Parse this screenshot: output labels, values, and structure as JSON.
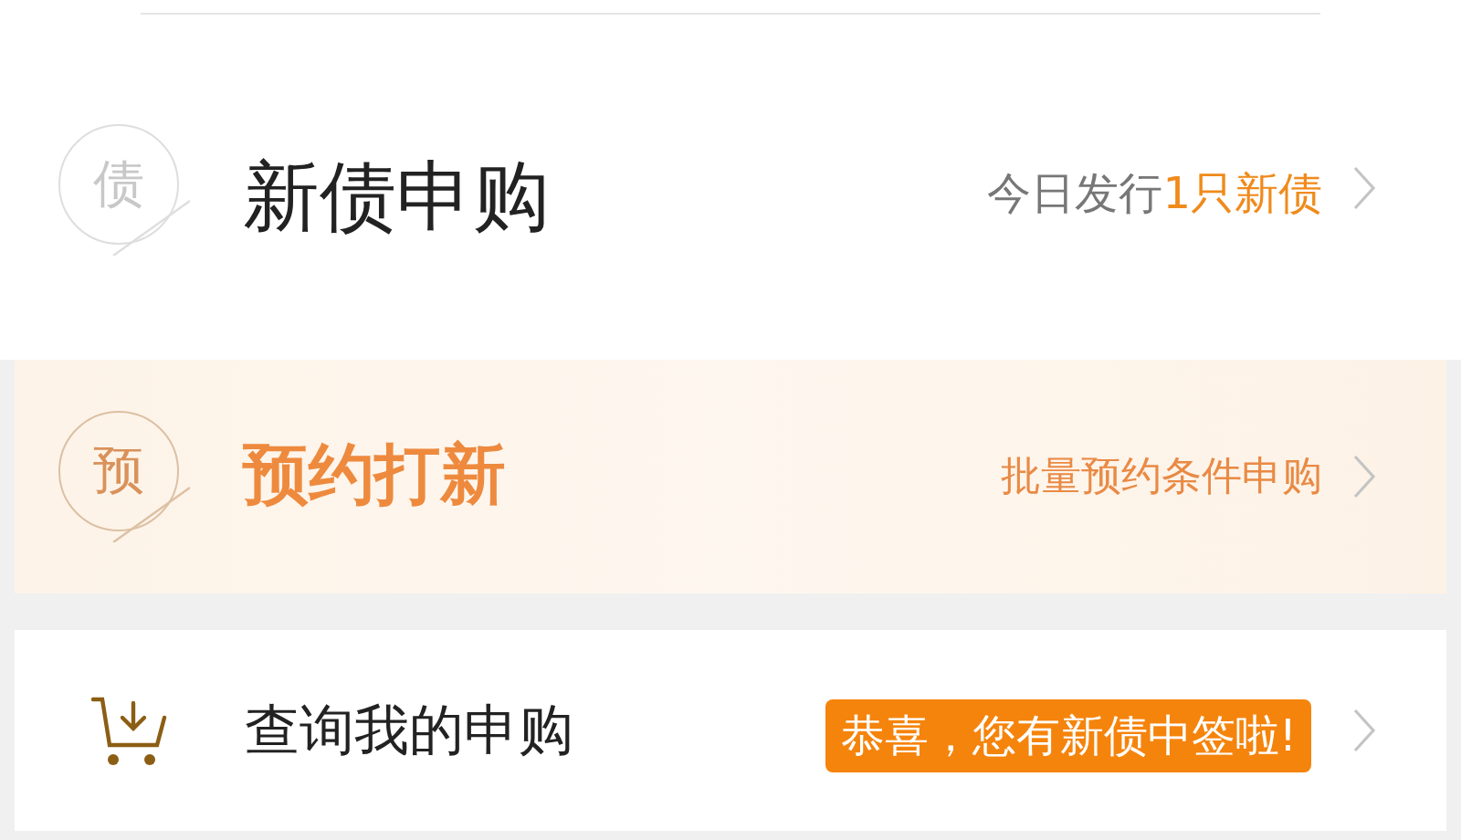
{
  "rows": [
    {
      "kind": "bond",
      "badge": "债",
      "title": "新债申购",
      "note": "今日发行",
      "note_highlight": "1只新债"
    },
    {
      "kind": "reserve",
      "badge": "预",
      "title": "预约打新",
      "note": "批量预约条件申购"
    },
    {
      "kind": "query",
      "title": "查询我的申购",
      "alert": "恭喜，您有新债中签啦!"
    }
  ]
}
